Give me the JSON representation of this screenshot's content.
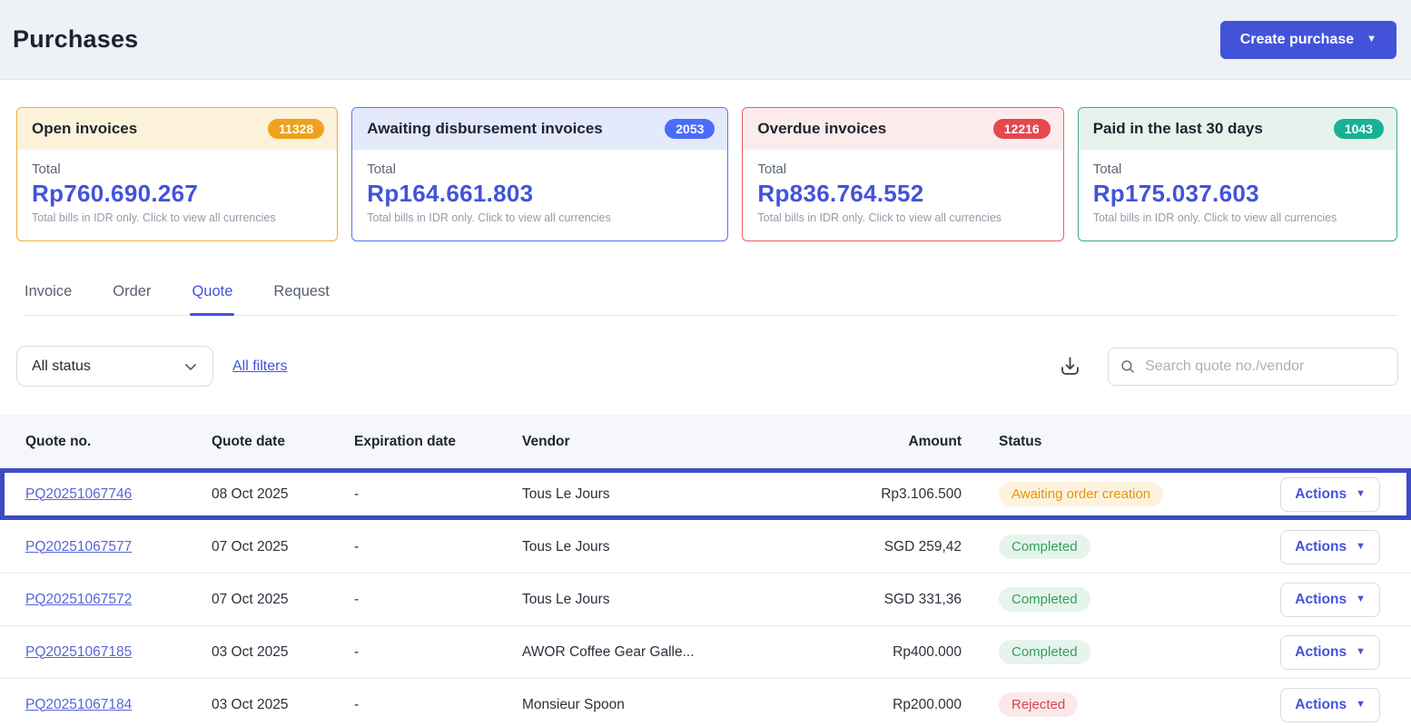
{
  "header": {
    "title": "Purchases",
    "create_button_label": "Create purchase"
  },
  "summary_cards": [
    {
      "title": "Open invoices",
      "count": "11328",
      "total_label": "Total",
      "amount": "Rp760.690.267",
      "note": "Total bills in IDR only. Click to view all currencies",
      "theme": "orange"
    },
    {
      "title": "Awaiting disbursement invoices",
      "count": "2053",
      "total_label": "Total",
      "amount": "Rp164.661.803",
      "note": "Total bills in IDR only. Click to view all currencies",
      "theme": "blue"
    },
    {
      "title": "Overdue invoices",
      "count": "12216",
      "total_label": "Total",
      "amount": "Rp836.764.552",
      "note": "Total bills in IDR only. Click to view all currencies",
      "theme": "red"
    },
    {
      "title": "Paid in the last 30 days",
      "count": "1043",
      "total_label": "Total",
      "amount": "Rp175.037.603",
      "note": "Total bills in IDR only. Click to view all currencies",
      "theme": "green"
    }
  ],
  "tabs": [
    {
      "label": "Invoice",
      "active": false
    },
    {
      "label": "Order",
      "active": false
    },
    {
      "label": "Quote",
      "active": true
    },
    {
      "label": "Request",
      "active": false
    }
  ],
  "filters": {
    "status_dropdown_value": "All status",
    "all_filters_label": "All filters",
    "search_placeholder": "Search quote no./vendor"
  },
  "table": {
    "columns": {
      "quote_no": "Quote no.",
      "quote_date": "Quote date",
      "expiration_date": "Expiration date",
      "vendor": "Vendor",
      "amount": "Amount",
      "status": "Status"
    },
    "actions_label": "Actions",
    "rows": [
      {
        "quote_no": "PQ20251067746",
        "quote_date": "08 Oct 2025",
        "expiration_date": "-",
        "vendor": "Tous Le Jours",
        "amount": "Rp3.106.500",
        "status": "Awaiting order creation",
        "status_type": "warning",
        "highlighted": true
      },
      {
        "quote_no": "PQ20251067577",
        "quote_date": "07 Oct 2025",
        "expiration_date": "-",
        "vendor": "Tous Le Jours",
        "amount": "SGD 259,42",
        "status": "Completed",
        "status_type": "success",
        "highlighted": false
      },
      {
        "quote_no": "PQ20251067572",
        "quote_date": "07 Oct 2025",
        "expiration_date": "-",
        "vendor": "Tous Le Jours",
        "amount": "SGD 331,36",
        "status": "Completed",
        "status_type": "success",
        "highlighted": false
      },
      {
        "quote_no": "PQ20251067185",
        "quote_date": "03 Oct 2025",
        "expiration_date": "-",
        "vendor": "AWOR Coffee Gear Galle...",
        "amount": "Rp400.000",
        "status": "Completed",
        "status_type": "success",
        "highlighted": false
      },
      {
        "quote_no": "PQ20251067184",
        "quote_date": "03 Oct 2025",
        "expiration_date": "-",
        "vendor": "Monsieur Spoon",
        "amount": "Rp200.000",
        "status": "Rejected",
        "status_type": "danger",
        "highlighted": false
      }
    ]
  },
  "colors": {
    "accent": "#4353d9",
    "link": "#4353d9",
    "amount": "#4353d9",
    "highlight_border": "#3d4bc6",
    "warning_text": "#e8940a",
    "warning_bg": "#fdf3dd",
    "success_text": "#359d60",
    "success_bg": "#e6f4eb",
    "danger_text": "#d9434a",
    "danger_bg": "#fbe9e9"
  }
}
